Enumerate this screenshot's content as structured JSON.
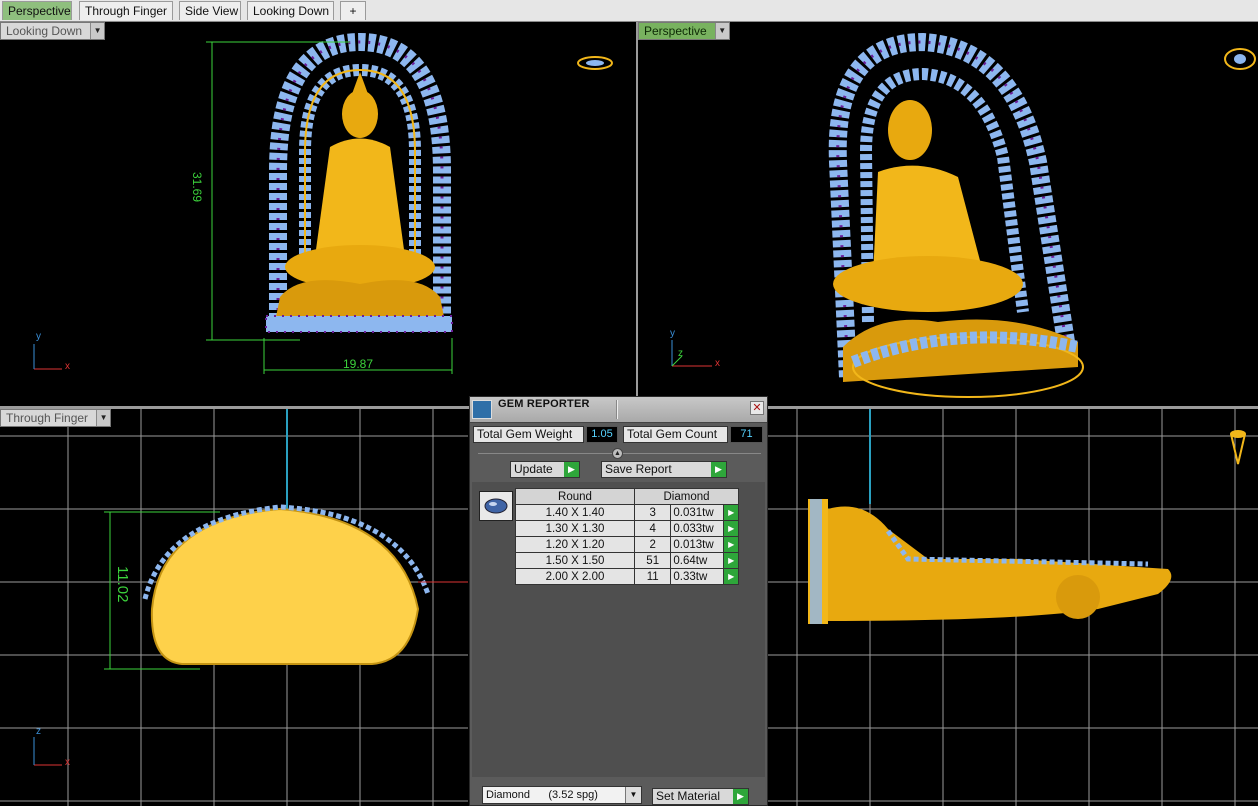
{
  "tabs": [
    "Perspective",
    "Through Finger",
    "Side View",
    "Looking Down",
    "+"
  ],
  "viewports": {
    "top_left": {
      "label": "Looking Down",
      "dim_height": "31.69",
      "dim_width": "19.87"
    },
    "top_right": {
      "label": "Perspective"
    },
    "bottom_left": {
      "label": "Through Finger",
      "dim_height": "11.02"
    }
  },
  "axis_labels": {
    "x": "x",
    "y": "y",
    "z": "z"
  },
  "gem_reporter": {
    "title": "GEM REPORTER",
    "close": "✕",
    "total_weight_label": "Total Gem Weight",
    "total_weight_value": "1.05",
    "total_count_label": "Total Gem Count",
    "total_count_value": "71",
    "update_label": "Update",
    "save_report_label": "Save Report",
    "table_headers": [
      "Round",
      "Diamond"
    ],
    "rows": [
      {
        "size": "1.40 X 1.40",
        "count": "3",
        "weight": "0.031tw"
      },
      {
        "size": "1.30 X 1.30",
        "count": "4",
        "weight": "0.033tw"
      },
      {
        "size": "1.20 X 1.20",
        "count": "2",
        "weight": "0.013tw"
      },
      {
        "size": "1.50 X 1.50",
        "count": "51",
        "weight": "0.64tw"
      },
      {
        "size": "2.00 X 2.00",
        "count": "11",
        "weight": "0.33tw"
      }
    ],
    "material_value": "Diamond      (3.52 spg)",
    "set_material_label": "Set Material"
  },
  "colors": {
    "gold": "#f2b71a",
    "stone": "#8db7ef",
    "prong": "#6b1e9a",
    "dimension": "#3cd33c",
    "tab_active": "#8fbf7e"
  }
}
